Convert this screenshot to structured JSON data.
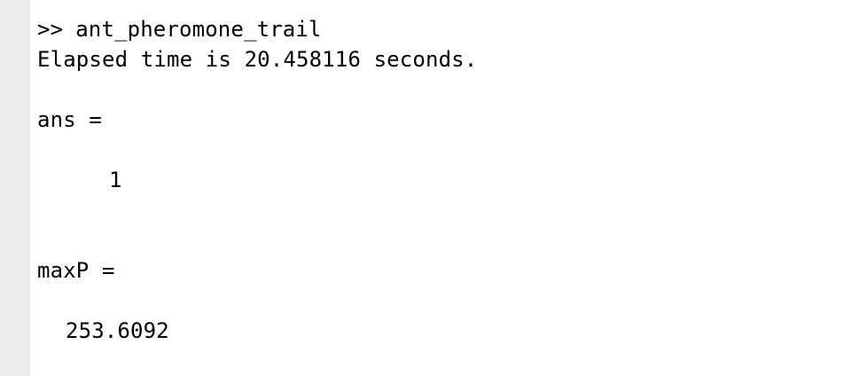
{
  "console": {
    "prompt": ">>",
    "command": "ant_pheromone_trail",
    "elapsed": "Elapsed time is 20.458116 seconds.",
    "ans_label": "ans =",
    "ans_value": "1",
    "maxp_label": "maxP =",
    "maxp_value": "253.6092"
  }
}
